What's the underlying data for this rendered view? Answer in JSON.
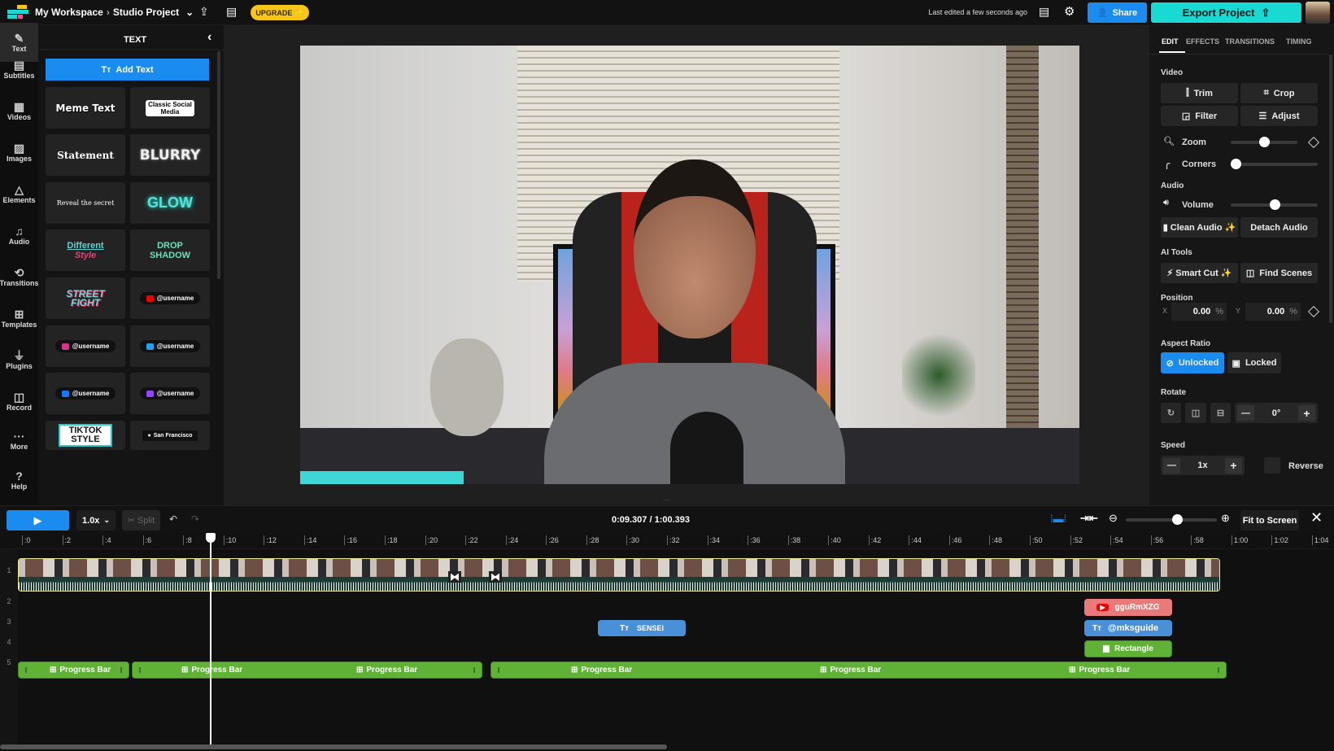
{
  "topbar": {
    "workspace": "My Workspace",
    "separator": "›",
    "project": "Studio Project",
    "upgrade": "UPGRADE",
    "last_edited": "Last edited a few seconds ago",
    "share": "Share",
    "export": "Export Project"
  },
  "rail": [
    {
      "label": "Text",
      "icon": "✎"
    },
    {
      "label": "Subtitles",
      "icon": "▤"
    },
    {
      "label": "Videos",
      "icon": "▦"
    },
    {
      "label": "Images",
      "icon": "▨"
    },
    {
      "label": "Elements",
      "icon": "△"
    },
    {
      "label": "Audio",
      "icon": "♫"
    },
    {
      "label": "Transitions",
      "icon": "⟲"
    },
    {
      "label": "Templates",
      "icon": "⊞"
    },
    {
      "label": "Plugins",
      "icon": "⏚"
    },
    {
      "label": "Record",
      "icon": "◫"
    },
    {
      "label": "More",
      "icon": "···"
    },
    {
      "label": "Help",
      "icon": "?"
    }
  ],
  "panel": {
    "title": "TEXT",
    "add_text": "Add Text",
    "add_icon": "Tт",
    "cards": [
      "Meme Text",
      "Classic Social Media",
      "Statement",
      "BLURRY",
      "Reveal the secret",
      "GLOW",
      "Different",
      "Style",
      "DROP SHADOW",
      "STREET FIGHT",
      "@username",
      "@username",
      "@username",
      "@username",
      "@username",
      "TIKTOK STYLE",
      "San Francisco"
    ]
  },
  "right": {
    "tabs": [
      "EDIT",
      "EFFECTS",
      "TRANSITIONS",
      "TIMING"
    ],
    "video": "Video",
    "trim": "Trim",
    "crop": "Crop",
    "filter": "Filter",
    "adjust": "Adjust",
    "zoom": "Zoom",
    "zoom_value": 0.5,
    "corners": "Corners",
    "corners_value": 0,
    "audio": "Audio",
    "volume": "Volume",
    "volume_value": 0.5,
    "clean_audio": "Clean Audio",
    "detach_audio": "Detach Audio",
    "ai_tools": "AI Tools",
    "smart_cut": "Smart Cut",
    "find_scenes": "Find Scenes",
    "position": "Position",
    "x_label": "X",
    "x_value": "0.00",
    "y_label": "Y",
    "y_value": "0.00",
    "percent": "%",
    "aspect": "Aspect Ratio",
    "unlocked": "Unlocked",
    "locked": "Locked",
    "rotate": "Rotate",
    "rotate_value": "0°",
    "speed": "Speed",
    "speed_value": "1x",
    "reverse": "Reverse"
  },
  "preview": {
    "progress_bar_fill": 0.21,
    "progress_color": "#3fd6d6"
  },
  "timeline": {
    "play": "▶",
    "speed": "1.0x",
    "split": "Split",
    "time": "0:09.307 / 1:00.393",
    "fit": "Fit to Screen",
    "zoom_value": 0.56,
    "playhead_seconds": 9.307,
    "ruler": [
      ":0",
      ":2",
      ":4",
      ":6",
      ":8",
      ":10",
      ":12",
      ":14",
      ":16",
      ":18",
      ":20",
      ":22",
      ":24",
      ":26",
      ":28",
      ":30",
      ":32",
      ":34",
      ":36",
      ":38",
      ":40",
      ":42",
      ":44",
      ":46",
      ":48",
      ":50",
      ":52",
      ":54",
      ":56",
      ":58",
      "1:00",
      "1:02",
      "1:04"
    ],
    "tracks": [
      "1",
      "2",
      "3",
      "4",
      "5"
    ],
    "sensei": "SENSEI",
    "youtube": "gguRmXZG",
    "mks": "@mksguide",
    "rectangle": "Rectangle",
    "progress": "Progress Bar"
  },
  "colors": {
    "accent": "#1a8cf0",
    "export": "#19d9d3",
    "upgrade": "#f5c518",
    "green": "#5fb236",
    "youtube_clip": "#e87a7a",
    "text_clip": "#4a90d9"
  }
}
